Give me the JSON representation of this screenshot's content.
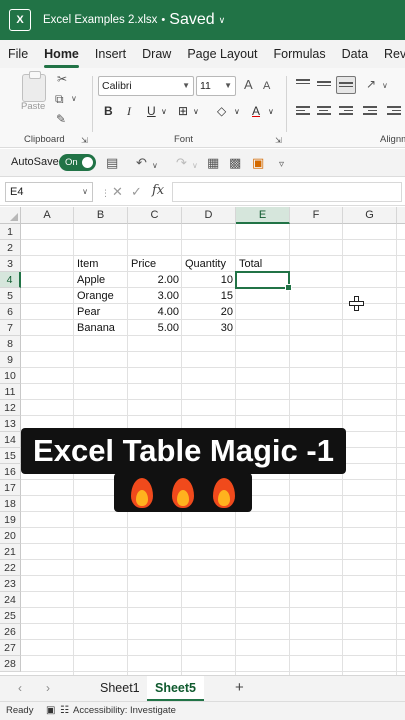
{
  "titlebar": {
    "app_icon": "excel-logo-icon",
    "logo_glyph": "X",
    "filename": "Excel Examples 2.xlsx",
    "separator": "•",
    "status": "Saved"
  },
  "ribbon_tabs": [
    "File",
    "Home",
    "Insert",
    "Draw",
    "Page Layout",
    "Formulas",
    "Data",
    "Review"
  ],
  "ribbon": {
    "paste_label": "Paste",
    "clipboard_label": "Clipboard",
    "font_name": "Calibri",
    "font_size": "11",
    "font_label": "Font",
    "alignment_label": "Alignm",
    "format_buttons": [
      "B",
      "I",
      "U",
      "A",
      "A"
    ],
    "font_size_buttons": [
      "A",
      "A"
    ]
  },
  "quick_access": {
    "autosave_label": "AutoSave",
    "toggle_label": "On"
  },
  "formula_bar": {
    "name_box": "E4",
    "fx_label": "fx",
    "formula": ""
  },
  "grid": {
    "columns": [
      "A",
      "B",
      "C",
      "D",
      "E",
      "F",
      "G"
    ],
    "selected_column": "E",
    "rows": [
      "1",
      "2",
      "3",
      "4",
      "5",
      "6",
      "7",
      "8",
      "9",
      "10",
      "11",
      "12",
      "13",
      "14",
      "15",
      "16",
      "17",
      "18",
      "19",
      "20",
      "21",
      "22",
      "23",
      "24",
      "25",
      "26",
      "27",
      "28"
    ],
    "selected_row": "4",
    "header_row": {
      "item": "Item",
      "price": "Price",
      "quantity": "Quantity",
      "total": "Total"
    },
    "data_rows": [
      {
        "item": "Apple",
        "price": "2.00",
        "quantity": "10"
      },
      {
        "item": "Orange",
        "price": "3.00",
        "quantity": "15"
      },
      {
        "item": "Pear",
        "price": "4.00",
        "quantity": "20"
      },
      {
        "item": "Banana",
        "price": "5.00",
        "quantity": "30"
      }
    ]
  },
  "overlay": {
    "title": "Excel Table Magic -1",
    "emoji_icon": "fire-icon"
  },
  "sheets": {
    "tabs": [
      "Sheet1",
      "Sheet5"
    ],
    "active": "Sheet5",
    "add_label": "+"
  },
  "statusbar": {
    "ready": "Ready",
    "accessibility": "Accessibility: Investigate"
  },
  "colors": {
    "accent": "#217346",
    "overlay_bg": "#111111"
  }
}
